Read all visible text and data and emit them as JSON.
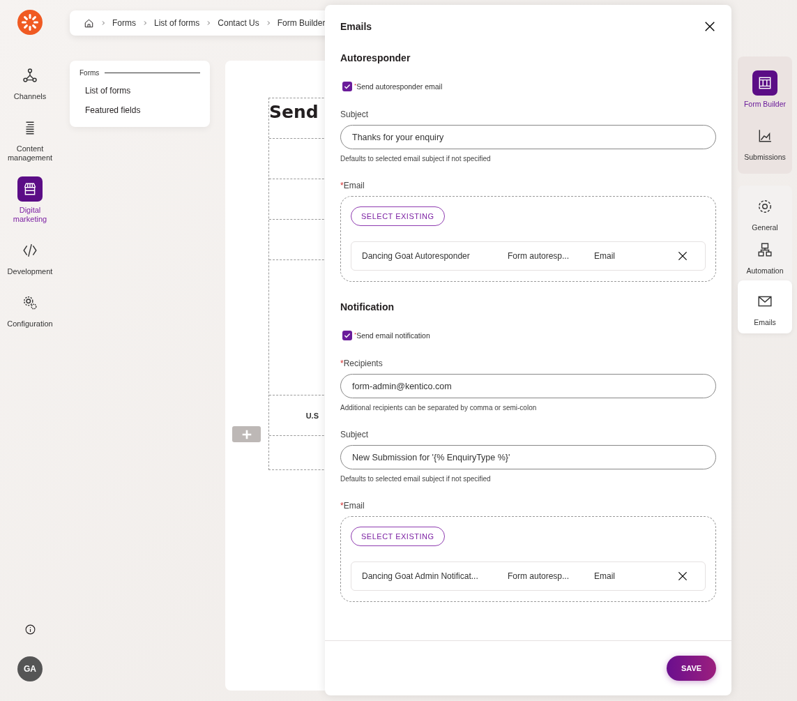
{
  "logo": {
    "kind": "logo"
  },
  "nav": {
    "items": [
      {
        "label": "Channels",
        "selected": false
      },
      {
        "label": "Content management",
        "selected": false
      },
      {
        "label": "Digital marketing",
        "selected": true
      },
      {
        "label": "Development",
        "selected": false
      },
      {
        "label": "Configuration",
        "selected": false
      }
    ],
    "user": {
      "initials": "GA"
    }
  },
  "breadcrumbs": [
    "Forms",
    "List of forms",
    "Contact Us",
    "Form Builder"
  ],
  "submenu": {
    "heading": "Forms",
    "items": [
      {
        "label": "List of forms"
      },
      {
        "label": "Featured fields"
      }
    ]
  },
  "canvas": {
    "heading": "Send",
    "field_text": "U.S"
  },
  "rail": [
    {
      "kind": "views",
      "items": [
        {
          "label": "Form Builder",
          "selected": true
        },
        {
          "label": "Submissions",
          "selected": false
        }
      ]
    },
    {
      "kind": "panels",
      "items": [
        {
          "label": "General",
          "selected": false
        },
        {
          "label": "Automation",
          "selected": false
        },
        {
          "label": "Emails",
          "selected": true
        }
      ]
    }
  ],
  "drawer": {
    "title": "Emails",
    "sections": [
      {
        "heading": "Autoresponder",
        "toggle": {
          "required_mark": "*",
          "label": "Send autoresponder email",
          "checked": true
        },
        "fields": [
          {
            "kind": "text",
            "label": "Subject",
            "value": "Thanks for your enquiry",
            "hint": "Defaults to selected email subject if not specified"
          },
          {
            "kind": "picker",
            "required_mark": "*",
            "label": "Email",
            "button": "SELECT EXISTING",
            "items": [
              {
                "name": "Dancing Goat Autoresponder",
                "type": "Form autoresp...",
                "channel": "Email"
              }
            ]
          }
        ]
      },
      {
        "heading": "Notification",
        "toggle": {
          "required_mark": "*",
          "label": "Send email notification",
          "checked": true
        },
        "fields": [
          {
            "kind": "text",
            "required_mark": "*",
            "label": "Recipients",
            "value": "form-admin@kentico.com",
            "hint": "Additional recipients can be separated by comma or semi-colon"
          },
          {
            "kind": "text",
            "label": "Subject",
            "value": "New Submission for '{% EnquiryType %}'",
            "hint": "Defaults to selected email subject if not specified"
          },
          {
            "kind": "picker",
            "required_mark": "*",
            "label": "Email",
            "button": "SELECT EXISTING",
            "items": [
              {
                "name": "Dancing Goat Admin Notificat...",
                "type": "Form autoresp...",
                "channel": "Email"
              }
            ]
          }
        ]
      }
    ],
    "save_button": "SAVE"
  }
}
